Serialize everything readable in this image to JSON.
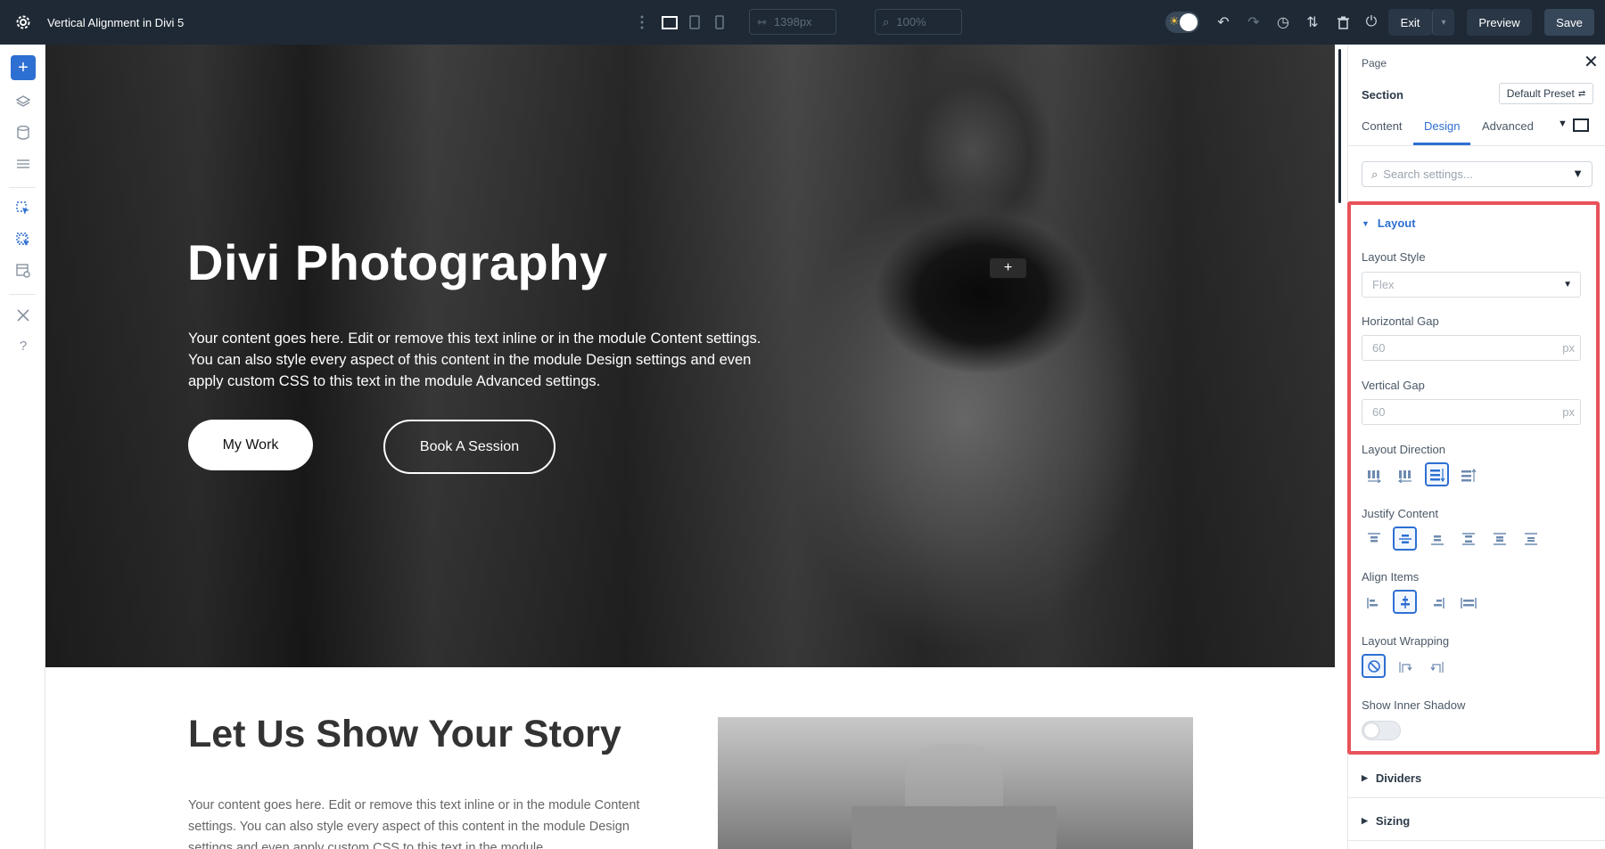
{
  "window": {
    "title": "Vertical Alignment in Divi 5"
  },
  "toolbar": {
    "width_value": "1398px",
    "zoom_value": "100%",
    "exit_label": "Exit",
    "preview_label": "Preview",
    "save_label": "Save"
  },
  "hero": {
    "title": "Divi Photography",
    "text": "Your content goes here. Edit or remove this text inline or in the module Content settings. You can also style every aspect of this content in the module Design settings and even apply custom CSS to this text in the module Advanced settings.",
    "button_primary": "My Work",
    "button_secondary": "Book A Session",
    "add_glyph": "+"
  },
  "story": {
    "title": "Let Us Show Your Story",
    "text": "Your content goes here. Edit or remove this text inline or in the module Content settings. You can also style every aspect of this content in the module Design settings and even apply custom CSS to this text in the module"
  },
  "panel": {
    "breadcrumb": "Page",
    "element": "Section",
    "preset": "Default Preset",
    "tabs": [
      {
        "label": "Content"
      },
      {
        "label": "Design"
      },
      {
        "label": "Advanced"
      }
    ],
    "active_tab": "Design",
    "search_placeholder": "Search settings...",
    "layout_group": "Layout",
    "layout_style_label": "Layout Style",
    "layout_style_value": "Flex",
    "hgap_label": "Horizontal Gap",
    "hgap_value": "60",
    "hgap_unit": "px",
    "vgap_label": "Vertical Gap",
    "vgap_value": "60",
    "vgap_unit": "px",
    "direction_label": "Layout Direction",
    "justify_label": "Justify Content",
    "align_label": "Align Items",
    "wrap_label": "Layout Wrapping",
    "shadow_label": "Show Inner Shadow",
    "dividers_group": "Dividers",
    "sizing_group": "Sizing"
  },
  "colors": {
    "accent": "#2e6fd2",
    "highlight": "#e8525a",
    "topbar": "#1e2935",
    "save": "#37475a"
  }
}
